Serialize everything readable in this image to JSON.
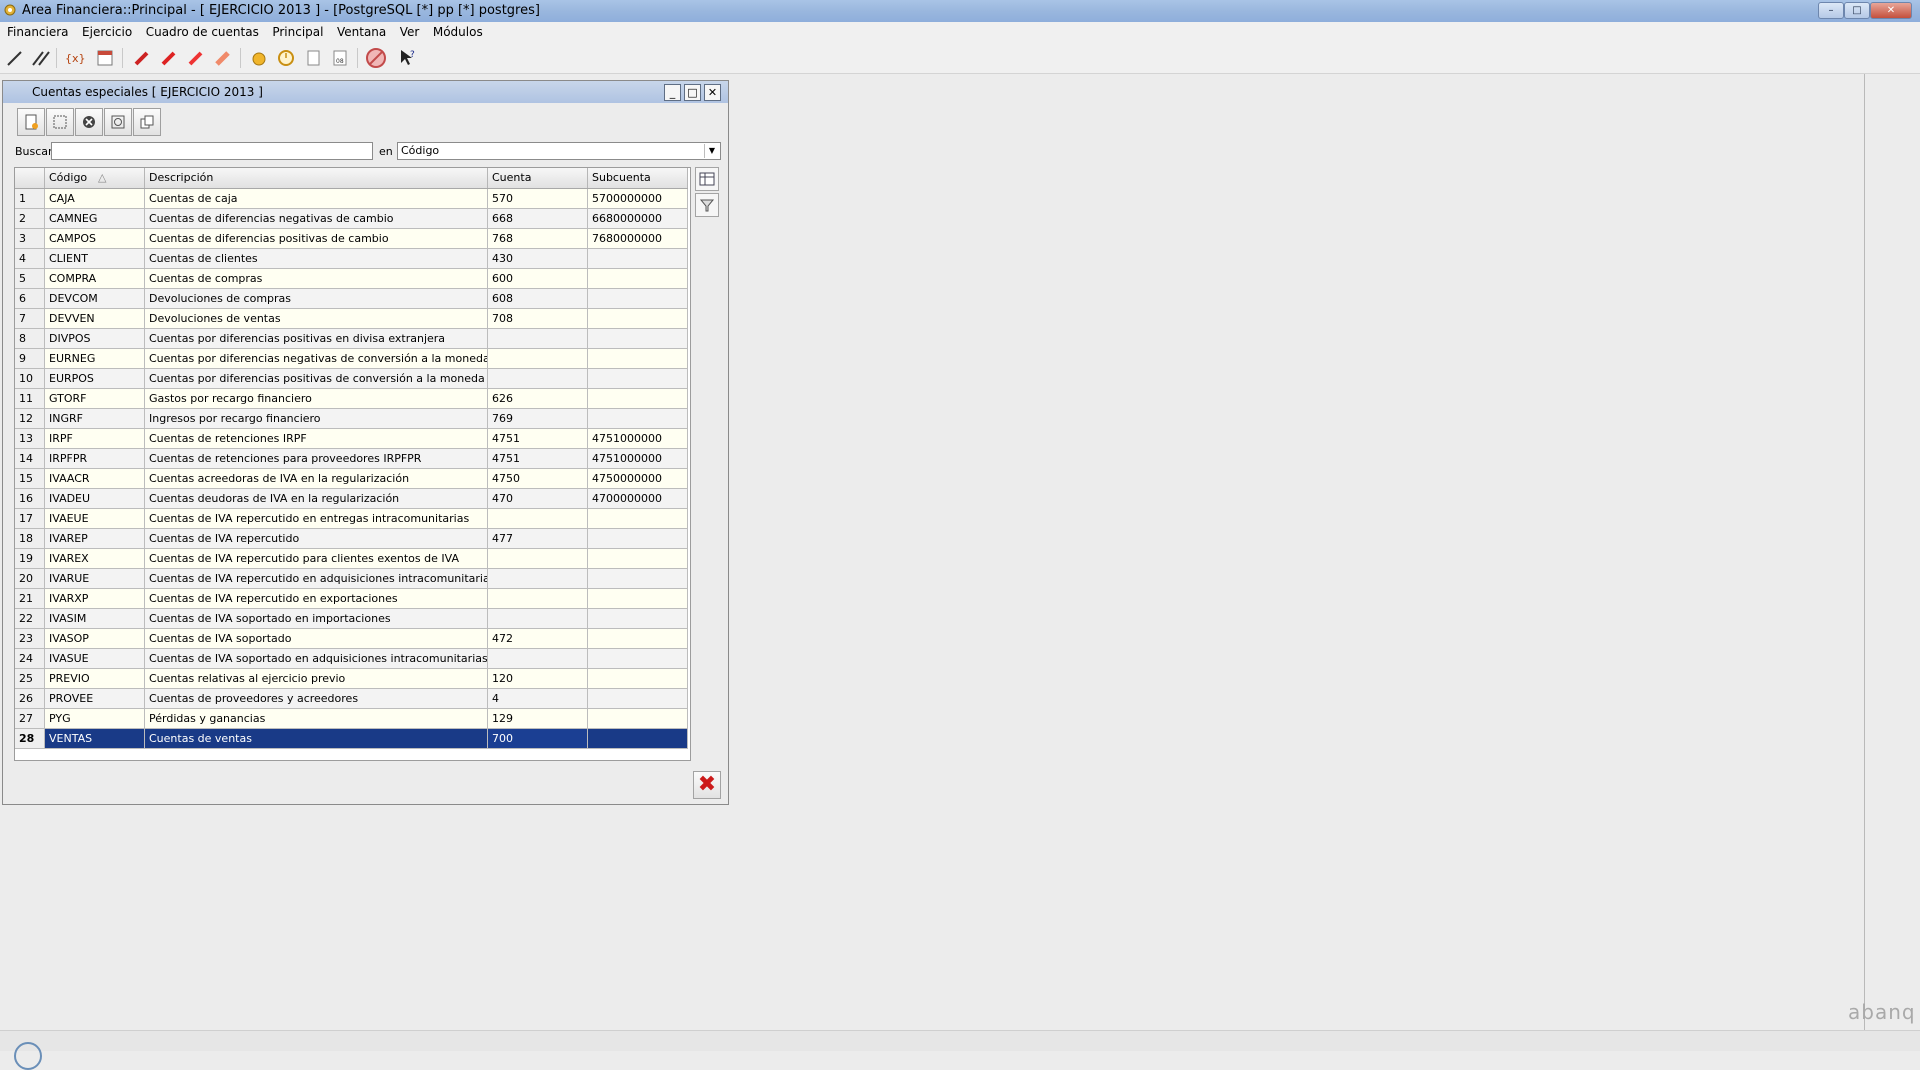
{
  "window": {
    "title": "Area Financiera::Principal  - [ EJERCICIO 2013 ] - [PostgreSQL [*] pp [*] postgres]",
    "controls": {
      "minimize": "–",
      "maximize": "□",
      "close": "✕"
    }
  },
  "menu": [
    "Financiera",
    "Ejercicio",
    "Cuadro de cuentas",
    "Principal",
    "Ventana",
    "Ver",
    "Módulos"
  ],
  "toolbar_icons": [
    "pencil-icon",
    "double-pencil-icon",
    "fx-icon",
    "calendar-icon",
    "red-pen-icon",
    "red-pen-2-icon",
    "red-pen-3-icon",
    "eraser-icon",
    "coins-icon",
    "clock-icon",
    "document-icon",
    "calendar-08-icon",
    "no-entry-icon",
    "help-cursor-icon"
  ],
  "subwindow": {
    "title": "Cuentas especiales [ EJERCICIO 2013 ]",
    "controls": {
      "minimize": "_",
      "maximize": "□",
      "close": "✕"
    }
  },
  "search": {
    "label": "Buscar",
    "value": "",
    "en_label": "en",
    "field": "Código"
  },
  "grid": {
    "headers": {
      "num": "",
      "codigo": "Código",
      "descripcion": "Descripción",
      "cuenta": "Cuenta",
      "subcuenta": "Subcuenta"
    },
    "sort_indicator": "△",
    "rows": [
      {
        "n": "1",
        "codigo": "CAJA",
        "descripcion": "Cuentas de caja",
        "cuenta": "570",
        "subcuenta": "5700000000"
      },
      {
        "n": "2",
        "codigo": "CAMNEG",
        "descripcion": "Cuentas de diferencias negativas de cambio",
        "cuenta": "668",
        "subcuenta": "6680000000"
      },
      {
        "n": "3",
        "codigo": "CAMPOS",
        "descripcion": "Cuentas de diferencias positivas de cambio",
        "cuenta": "768",
        "subcuenta": "7680000000"
      },
      {
        "n": "4",
        "codigo": "CLIENT",
        "descripcion": "Cuentas de clientes",
        "cuenta": "430",
        "subcuenta": ""
      },
      {
        "n": "5",
        "codigo": "COMPRA",
        "descripcion": "Cuentas de compras",
        "cuenta": "600",
        "subcuenta": ""
      },
      {
        "n": "6",
        "codigo": "DEVCOM",
        "descripcion": "Devoluciones de compras",
        "cuenta": "608",
        "subcuenta": ""
      },
      {
        "n": "7",
        "codigo": "DEVVEN",
        "descripcion": "Devoluciones de ventas",
        "cuenta": "708",
        "subcuenta": ""
      },
      {
        "n": "8",
        "codigo": "DIVPOS",
        "descripcion": "Cuentas por diferencias positivas en divisa extranjera",
        "cuenta": "",
        "subcuenta": ""
      },
      {
        "n": "9",
        "codigo": "EURNEG",
        "descripcion": "Cuentas por diferencias negativas de conversión a la moneda local",
        "cuenta": "",
        "subcuenta": ""
      },
      {
        "n": "10",
        "codigo": "EURPOS",
        "descripcion": "Cuentas por diferencias positivas de conversión a la moneda local",
        "cuenta": "",
        "subcuenta": ""
      },
      {
        "n": "11",
        "codigo": "GTORF",
        "descripcion": "Gastos por recargo financiero",
        "cuenta": "626",
        "subcuenta": ""
      },
      {
        "n": "12",
        "codigo": "INGRF",
        "descripcion": "Ingresos por recargo financiero",
        "cuenta": "769",
        "subcuenta": ""
      },
      {
        "n": "13",
        "codigo": "IRPF",
        "descripcion": "Cuentas de retenciones IRPF",
        "cuenta": "4751",
        "subcuenta": "4751000000"
      },
      {
        "n": "14",
        "codigo": "IRPFPR",
        "descripcion": "Cuentas de retenciones para proveedores IRPFPR",
        "cuenta": "4751",
        "subcuenta": "4751000000"
      },
      {
        "n": "15",
        "codigo": "IVAACR",
        "descripcion": "Cuentas acreedoras de IVA en la regularización",
        "cuenta": "4750",
        "subcuenta": "4750000000"
      },
      {
        "n": "16",
        "codigo": "IVADEU",
        "descripcion": "Cuentas deudoras de IVA en la regularización",
        "cuenta": "470",
        "subcuenta": "4700000000"
      },
      {
        "n": "17",
        "codigo": "IVAEUE",
        "descripcion": "Cuentas de IVA repercutido en entregas intracomunitarias",
        "cuenta": "",
        "subcuenta": ""
      },
      {
        "n": "18",
        "codigo": "IVAREP",
        "descripcion": "Cuentas de IVA repercutido",
        "cuenta": "477",
        "subcuenta": ""
      },
      {
        "n": "19",
        "codigo": "IVAREX",
        "descripcion": "Cuentas de IVA repercutido para clientes exentos de IVA",
        "cuenta": "",
        "subcuenta": ""
      },
      {
        "n": "20",
        "codigo": "IVARUE",
        "descripcion": "Cuentas de IVA repercutido en adquisiciones intracomunitarias",
        "cuenta": "",
        "subcuenta": ""
      },
      {
        "n": "21",
        "codigo": "IVARXP",
        "descripcion": "Cuentas de IVA repercutido en exportaciones",
        "cuenta": "",
        "subcuenta": ""
      },
      {
        "n": "22",
        "codigo": "IVASIM",
        "descripcion": "Cuentas de IVA soportado en importaciones",
        "cuenta": "",
        "subcuenta": ""
      },
      {
        "n": "23",
        "codigo": "IVASOP",
        "descripcion": "Cuentas de IVA soportado",
        "cuenta": "472",
        "subcuenta": ""
      },
      {
        "n": "24",
        "codigo": "IVASUE",
        "descripcion": "Cuentas de IVA soportado en adquisiciones intracomunitarias",
        "cuenta": "",
        "subcuenta": ""
      },
      {
        "n": "25",
        "codigo": "PREVIO",
        "descripcion": "Cuentas relativas al ejercicio previo",
        "cuenta": "120",
        "subcuenta": ""
      },
      {
        "n": "26",
        "codigo": "PROVEE",
        "descripcion": "Cuentas de proveedores y acreedores",
        "cuenta": "4",
        "subcuenta": ""
      },
      {
        "n": "27",
        "codigo": "PYG",
        "descripcion": "Pérdidas y ganancias",
        "cuenta": "129",
        "subcuenta": ""
      },
      {
        "n": "28",
        "codigo": "VENTAS",
        "descripcion": "Cuentas de ventas",
        "cuenta": "700",
        "subcuenta": ""
      }
    ],
    "selected_row": "28"
  },
  "footer": {
    "close_button_glyph": "✖"
  },
  "branding": {
    "logo_text": "abanq"
  },
  "colors": {
    "selected_row": "#193a87",
    "odd_row": "#fffff2",
    "even_row": "#f3f3f3"
  }
}
